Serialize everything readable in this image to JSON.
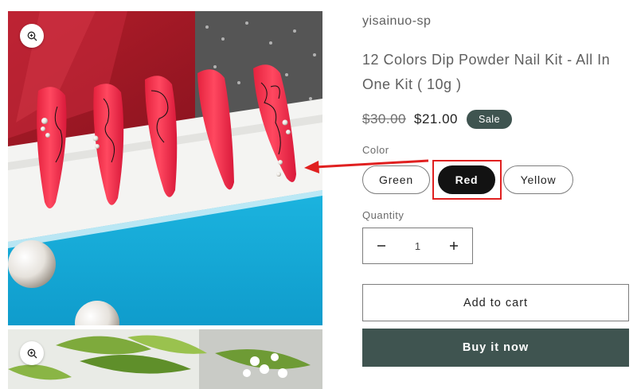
{
  "product": {
    "vendor": "yisainuo-sp",
    "title": "12 Colors Dip Powder Nail Kit - All In One Kit ( 10g )",
    "price_compare": "$30.00",
    "price_current": "$21.00",
    "sale_badge": "Sale"
  },
  "variant": {
    "label": "Color",
    "options": [
      "Green",
      "Red",
      "Yellow"
    ],
    "selected": "Red"
  },
  "quantity": {
    "label": "Quantity",
    "value": "1",
    "decrease_icon": "minus-icon",
    "increase_icon": "plus-icon"
  },
  "actions": {
    "add_to_cart": "Add to cart",
    "buy_now": "Buy it now"
  },
  "gallery": {
    "zoom_icon": "zoom-in-icon",
    "images": [
      "red-nail-tips-photo",
      "green-leaves-photo"
    ]
  },
  "annotation": {
    "arrow_color": "#e02020",
    "box_color": "#e02020"
  },
  "colors": {
    "accent": "#3f5450",
    "selected_pill": "#121212"
  }
}
